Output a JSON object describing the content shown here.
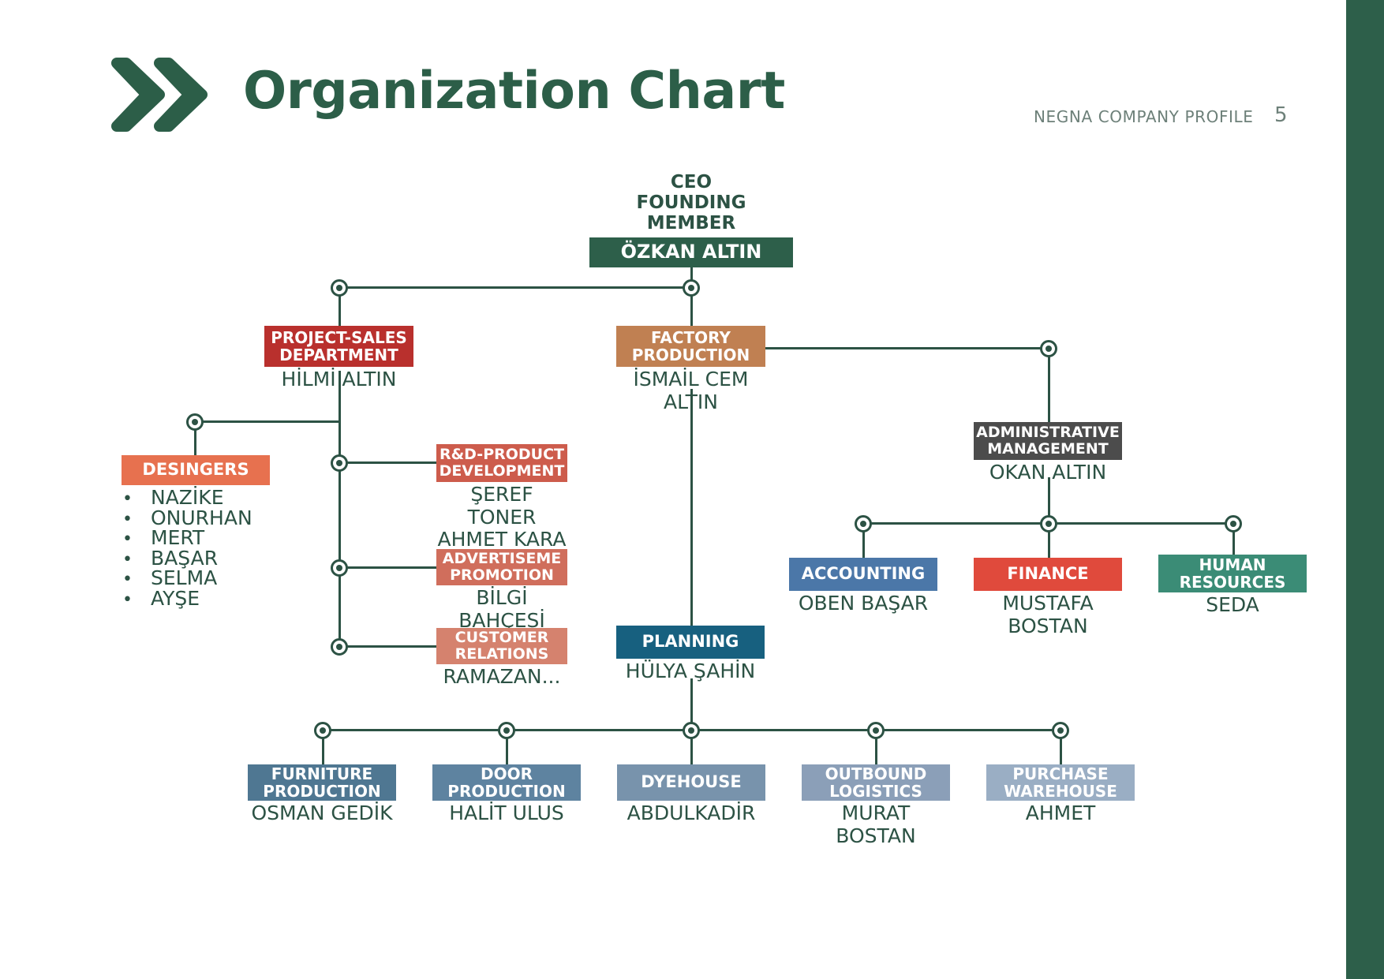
{
  "header": {
    "title": "Organization Chart",
    "profile_label": "NEGNA COMPANY PROFILE",
    "page_number": "5",
    "logo_icon": "double-chevron-right-icon"
  },
  "colors": {
    "brand_green": "#2d5f4a",
    "line": "#2c5244",
    "ceo": "#2d5f4a",
    "project_sales": "#b9302d",
    "factory": "#c08052",
    "designers": "#e7714f",
    "rd": "#cd5c4c",
    "advertisement": "#d06e5c",
    "customer_relations": "#d5826e",
    "admin": "#4c4c4c",
    "accounting": "#4b77a8",
    "finance": "#e04a3c",
    "human_resources": "#3b8c76",
    "planning": "#17607f",
    "furniture": "#4f7792",
    "door": "#5e83a0",
    "dyehouse": "#7893ac",
    "outbound": "#8b9fb8",
    "purchase": "#9aaec4"
  },
  "chart_data": {
    "type": "diagram",
    "title": "Organization Chart",
    "nodes": [
      {
        "id": "ceo",
        "label_above": "CEO\nFOUNDING MEMBER",
        "box_title": "ÖZKAN ALTIN",
        "color": "#2d5f4a",
        "level": 0
      },
      {
        "id": "project-sales",
        "box_title": "PROJECT-SALES\nDEPARTMENT",
        "person": "HİLMİ ALTIN",
        "color": "#b9302d",
        "parent": "ceo"
      },
      {
        "id": "factory-production",
        "box_title": "FACTORY\nPRODUCTION",
        "person": "İSMAİL CEM ALTIN",
        "color": "#c08052",
        "parent": "ceo"
      },
      {
        "id": "designers",
        "box_title": "DESINGERS",
        "person": "",
        "color": "#e7714f",
        "parent": "project-sales",
        "members": [
          "NAZİKE",
          "ONURHAN",
          "MERT",
          "BAŞAR",
          "SELMA",
          "AYŞE"
        ]
      },
      {
        "id": "rd-product-development",
        "box_title": "R&D-PRODUCT\nDEVELOPMENT",
        "person": "ŞEREF TONER\nAHMET KARA\nRAMAZAN...",
        "color": "#cd5c4c",
        "parent": "project-sales"
      },
      {
        "id": "advertisement-promotion",
        "box_title": "ADVERTISEME\nPROMOTION",
        "person": "BİLGİ BAHÇESİ",
        "color": "#d06e5c",
        "parent": "project-sales"
      },
      {
        "id": "customer-relations",
        "box_title": "CUSTOMER\nRELATIONS",
        "person": "RAMAZAN...",
        "color": "#d5826e",
        "parent": "project-sales"
      },
      {
        "id": "administrative-management",
        "box_title": "ADMINISTRATIVE\nMANAGEMENT",
        "person": "OKAN ALTIN",
        "color": "#4c4c4c",
        "parent": "factory-production"
      },
      {
        "id": "accounting",
        "box_title": "ACCOUNTING",
        "person": "OBEN BAŞAR",
        "color": "#4b77a8",
        "parent": "administrative-management"
      },
      {
        "id": "finance",
        "box_title": "FINANCE",
        "person": "MUSTAFA BOSTAN",
        "color": "#e04a3c",
        "parent": "administrative-management"
      },
      {
        "id": "human-resources",
        "box_title": "HUMAN\nRESOURCES",
        "person": "SEDA",
        "color": "#3b8c76",
        "parent": "administrative-management"
      },
      {
        "id": "planning",
        "box_title": "PLANNING",
        "person": "HÜLYA ŞAHİN",
        "color": "#17607f",
        "parent": "factory-production"
      },
      {
        "id": "furniture-production",
        "box_title": "FURNITURE\nPRODUCTION",
        "person": "OSMAN GEDİK",
        "color": "#4f7792",
        "parent": "planning"
      },
      {
        "id": "door-production",
        "box_title": "DOOR\nPRODUCTION",
        "person": "HALİT ULUS",
        "color": "#5e83a0",
        "parent": "planning"
      },
      {
        "id": "dyehouse",
        "box_title": "DYEHOUSE",
        "person": "ABDULKADİR",
        "color": "#7893ac",
        "parent": "planning"
      },
      {
        "id": "outbound-logistics",
        "box_title": "OUTBOUND\nLOGISTICS",
        "person": "MURAT BOSTAN",
        "color": "#8b9fb8",
        "parent": "planning"
      },
      {
        "id": "purchase-warehouse",
        "box_title": "PURCHASE\nWAREHOUSE",
        "person": "AHMET",
        "color": "#9aaec4",
        "parent": "planning"
      }
    ]
  },
  "nodes": {
    "ceo": {
      "label_line1": "CEO",
      "label_line2": "FOUNDING MEMBER",
      "name": "ÖZKAN ALTIN"
    },
    "project_sales": {
      "title_line1": "PROJECT-SALES",
      "title_line2": "DEPARTMENT",
      "person": "HİLMİ ALTIN"
    },
    "factory": {
      "title_line1": "FACTORY",
      "title_line2": "PRODUCTION",
      "person": "İSMAİL CEM ALTIN"
    },
    "designers": {
      "title": "DESINGERS",
      "members": [
        "NAZİKE",
        "ONURHAN",
        "MERT",
        "BAŞAR",
        "SELMA",
        "AYŞE"
      ],
      "bullet": "•"
    },
    "rd": {
      "title_line1": "R&D-PRODUCT",
      "title_line2": "DEVELOPMENT",
      "person_line1": "ŞEREF TONER",
      "person_line2": "AHMET KARA",
      "person_line3": "RAMAZAN..."
    },
    "advertisement": {
      "title_line1": "ADVERTISEME",
      "title_line2": "PROMOTION",
      "person": "BİLGİ BAHÇESİ"
    },
    "customer_relations": {
      "title_line1": "CUSTOMER",
      "title_line2": "RELATIONS",
      "person": "RAMAZAN..."
    },
    "admin": {
      "title_line1": "ADMINISTRATIVE",
      "title_line2": "MANAGEMENT",
      "person": "OKAN ALTIN"
    },
    "accounting": {
      "title": "ACCOUNTING",
      "person": "OBEN BAŞAR"
    },
    "finance": {
      "title": "FINANCE",
      "person": "MUSTAFA BOSTAN"
    },
    "human_resources": {
      "title_line1": "HUMAN",
      "title_line2": "RESOURCES",
      "person": "SEDA"
    },
    "planning": {
      "title": "PLANNING",
      "person": "HÜLYA ŞAHİN"
    },
    "furniture": {
      "title_line1": "FURNITURE",
      "title_line2": "PRODUCTION",
      "person": "OSMAN GEDİK"
    },
    "door": {
      "title_line1": "DOOR",
      "title_line2": "PRODUCTION",
      "person": "HALİT ULUS"
    },
    "dyehouse": {
      "title": "DYEHOUSE",
      "person": "ABDULKADİR"
    },
    "outbound": {
      "title_line1": "OUTBOUND",
      "title_line2": "LOGISTICS",
      "person": "MURAT BOSTAN"
    },
    "purchase": {
      "title_line1": "PURCHASE",
      "title_line2": "WAREHOUSE",
      "person": "AHMET"
    }
  }
}
